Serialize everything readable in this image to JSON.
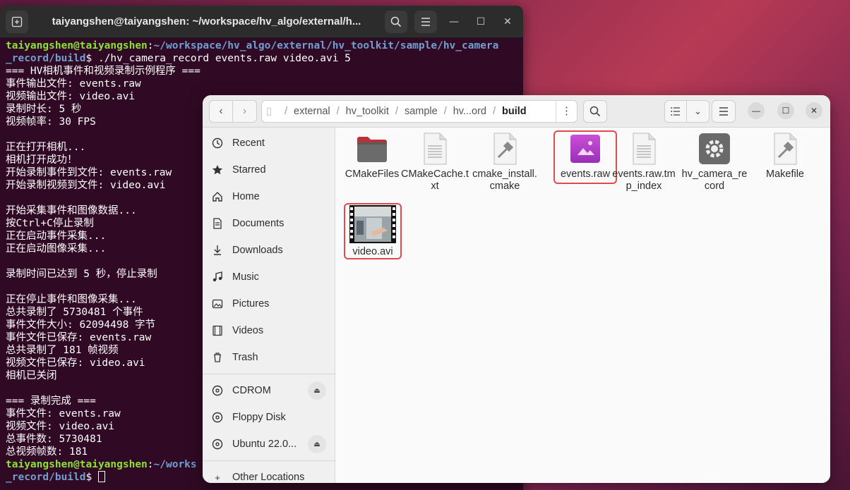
{
  "terminal": {
    "title": "taiyangshen@taiyangshen: ~/workspace/hv_algo/external/h...",
    "lines": [
      {
        "user": "taiyangshen@taiyangshen",
        "sep": ":",
        "path": "~/workspace/hv_algo/external/hv_toolkit/sample/hv_camera",
        "rest": ""
      },
      {
        "user": "",
        "sep": "",
        "path": "_record/build",
        "rest": "$ ./hv_camera_record events.raw video.avi 5"
      },
      {
        "text": "=== HV相机事件和视频录制示例程序 ==="
      },
      {
        "text": "事件输出文件: events.raw"
      },
      {
        "text": "视频输出文件: video.avi"
      },
      {
        "text": "录制时长: 5 秒"
      },
      {
        "text": "视频帧率: 30 FPS"
      },
      {
        "text": ""
      },
      {
        "text": "正在打开相机..."
      },
      {
        "text": "相机打开成功！"
      },
      {
        "text": "开始录制事件到文件: events.raw"
      },
      {
        "text": "开始录制视频到文件: video.avi"
      },
      {
        "text": ""
      },
      {
        "text": "开始采集事件和图像数据..."
      },
      {
        "text": "按Ctrl+C停止录制"
      },
      {
        "text": "正在启动事件采集..."
      },
      {
        "text": "正在启动图像采集..."
      },
      {
        "text": ""
      },
      {
        "text": "录制时间已达到 5 秒，停止录制"
      },
      {
        "text": ""
      },
      {
        "text": "正在停止事件和图像采集..."
      },
      {
        "text": "总共录制了 5730481 个事件"
      },
      {
        "text": "事件文件大小: 62094498 字节"
      },
      {
        "text": "事件文件已保存: events.raw"
      },
      {
        "text": "总共录制了 181 帧视频"
      },
      {
        "text": "视频文件已保存: video.avi"
      },
      {
        "text": "相机已关闭"
      },
      {
        "text": ""
      },
      {
        "text": "=== 录制完成 ==="
      },
      {
        "text": "事件文件: events.raw"
      },
      {
        "text": "视频文件: video.avi"
      },
      {
        "text": "总事件数: 5730481"
      },
      {
        "text": "总视频帧数: 181"
      },
      {
        "user": "taiyangshen@taiyangshen",
        "sep": ":",
        "path": "~/works",
        "rest": ""
      },
      {
        "user": "",
        "sep": "",
        "path": "_record/build",
        "rest": "$ ",
        "cursor": true
      }
    ]
  },
  "files": {
    "breadcrumb": [
      "external",
      "hv_toolkit",
      "sample",
      "hv...ord",
      "build"
    ],
    "sidebar": [
      {
        "label": "Recent",
        "icon": "clock-icon"
      },
      {
        "label": "Starred",
        "icon": "star-icon"
      },
      {
        "label": "Home",
        "icon": "home-icon"
      },
      {
        "label": "Documents",
        "icon": "document-icon"
      },
      {
        "label": "Downloads",
        "icon": "download-icon"
      },
      {
        "label": "Music",
        "icon": "music-icon"
      },
      {
        "label": "Pictures",
        "icon": "pictures-icon"
      },
      {
        "label": "Videos",
        "icon": "videos-icon"
      },
      {
        "label": "Trash",
        "icon": "trash-icon"
      }
    ],
    "devices": [
      {
        "label": "CDROM",
        "eject": true
      },
      {
        "label": "Floppy Disk",
        "eject": false
      },
      {
        "label": "Ubuntu 22.0...",
        "eject": true
      }
    ],
    "other": {
      "label": "Other Locations"
    },
    "items": [
      {
        "name": "CMakeFiles",
        "icon": "folder-icon"
      },
      {
        "name": "CMakeCache.txt",
        "icon": "text-file-icon"
      },
      {
        "name": "cmake_install.cmake",
        "icon": "script-file-icon"
      },
      {
        "name": "events.raw",
        "icon": "image-file-icon"
      },
      {
        "name": "events.raw.tmp_index",
        "icon": "text-file-icon"
      },
      {
        "name": "hv_camera_record",
        "icon": "executable-icon"
      },
      {
        "name": "Makefile",
        "icon": "script-file-icon"
      },
      {
        "name": "video.avi",
        "icon": "video-thumbnail-icon"
      }
    ]
  }
}
